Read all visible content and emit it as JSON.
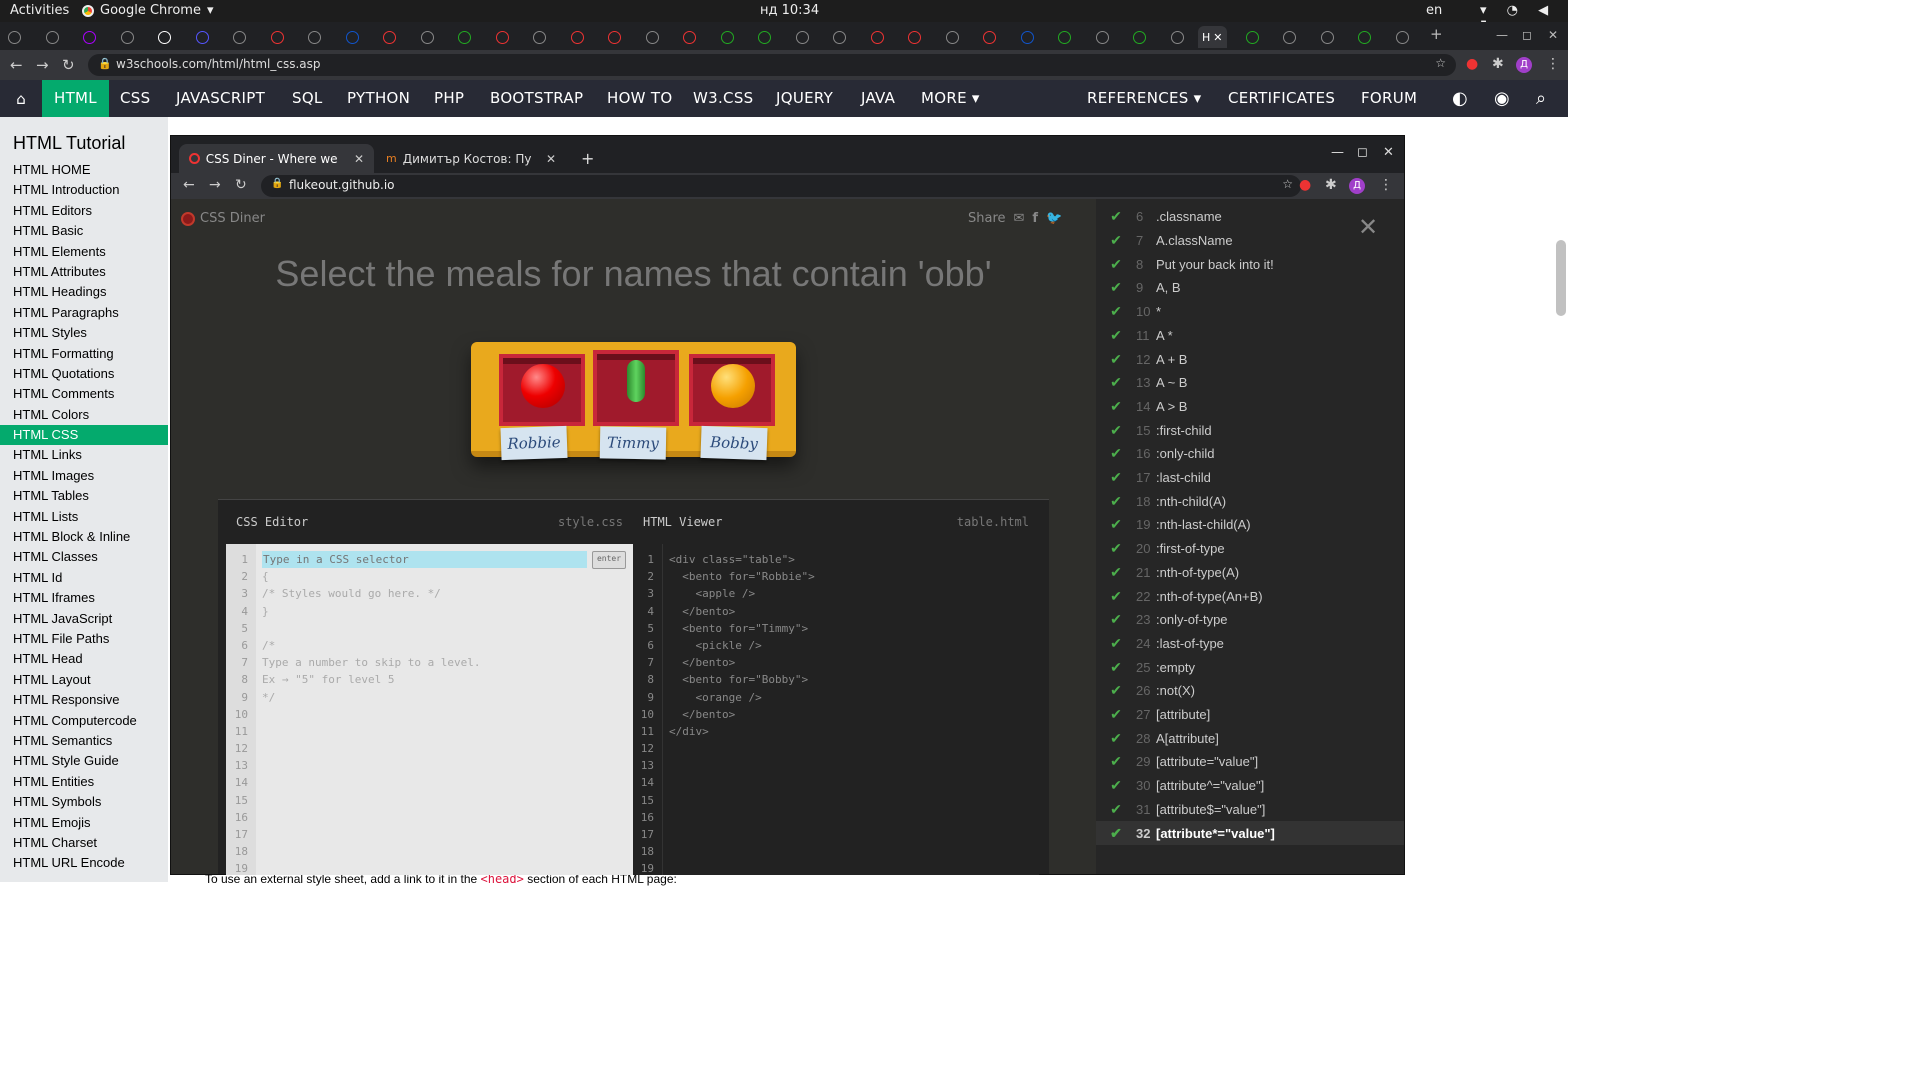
{
  "os": {
    "activities": "Activities",
    "app": "Google Chrome",
    "clock": "нд 10:34",
    "lang": "en"
  },
  "browser": {
    "url": "w3schools.com/html/html_css.asp",
    "active_tab": "H"
  },
  "w3nav": {
    "items": [
      "HTML",
      "CSS",
      "JAVASCRIPT",
      "SQL",
      "PYTHON",
      "PHP",
      "BOOTSTRAP",
      "HOW TO",
      "W3.CSS",
      "JQUERY",
      "JAVA",
      "MORE ▾"
    ],
    "right": [
      "REFERENCES ▾",
      "CERTIFICATES",
      "FORUM"
    ]
  },
  "sidebar": {
    "title": "HTML Tutorial",
    "items": [
      "HTML HOME",
      "HTML Introduction",
      "HTML Editors",
      "HTML Basic",
      "HTML Elements",
      "HTML Attributes",
      "HTML Headings",
      "HTML Paragraphs",
      "HTML Styles",
      "HTML Formatting",
      "HTML Quotations",
      "HTML Comments",
      "HTML Colors",
      "HTML CSS",
      "HTML Links",
      "HTML Images",
      "HTML Tables",
      "HTML Lists",
      "HTML Block & Inline",
      "HTML Classes",
      "HTML Id",
      "HTML Iframes",
      "HTML JavaScript",
      "HTML File Paths",
      "HTML Head",
      "HTML Layout",
      "HTML Responsive",
      "HTML Computercode",
      "HTML Semantics",
      "HTML Style Guide",
      "HTML Entities",
      "HTML Symbols",
      "HTML Emojis",
      "HTML Charset",
      "HTML URL Encode"
    ],
    "active": "HTML CSS"
  },
  "bottom_text": {
    "before": "To use an external style sheet, add a link to it in the ",
    "code": "<head>",
    "after": " section of each HTML page:"
  },
  "popup": {
    "tabs": [
      "CSS Diner - Where we feas",
      "Димитър Костов: Публи"
    ],
    "url": "flukeout.github.io",
    "brand": "CSS Diner",
    "share": "Share",
    "instruction": "Select the meals for names that contain 'obb'",
    "bentos": [
      {
        "name": "Robbie",
        "food": "apple"
      },
      {
        "name": "Timmy",
        "food": "pickle"
      },
      {
        "name": "Bobby",
        "food": "orange"
      }
    ],
    "css_editor": {
      "title": "CSS Editor",
      "file": "style.css",
      "placeholder": "Type in a CSS selector",
      "enter": "enter",
      "lines": [
        "{",
        "/* Styles would go here. */",
        "}",
        "",
        "/*",
        "Type a number to skip to a level.",
        "Ex → \"5\" for level 5",
        "*/"
      ]
    },
    "html_viewer": {
      "title": "HTML Viewer",
      "file": "table.html",
      "lines": [
        "<div class=\"table\">",
        "  <bento for=\"Robbie\">",
        "    <apple />",
        "  </bento>",
        "  <bento for=\"Timmy\">",
        "    <pickle />",
        "  </bento>",
        "  <bento for=\"Bobby\">",
        "    <orange />",
        "  </bento>",
        "</div>"
      ]
    },
    "levels": [
      {
        "n": "6",
        "t": ".classname"
      },
      {
        "n": "7",
        "t": "A.className"
      },
      {
        "n": "8",
        "t": "Put your back into it!"
      },
      {
        "n": "9",
        "t": "A, B"
      },
      {
        "n": "10",
        "t": "*"
      },
      {
        "n": "11",
        "t": "A *"
      },
      {
        "n": "12",
        "t": "A + B"
      },
      {
        "n": "13",
        "t": "A ~ B"
      },
      {
        "n": "14",
        "t": "A > B"
      },
      {
        "n": "15",
        "t": ":first-child"
      },
      {
        "n": "16",
        "t": ":only-child"
      },
      {
        "n": "17",
        "t": ":last-child"
      },
      {
        "n": "18",
        "t": ":nth-child(A)"
      },
      {
        "n": "19",
        "t": ":nth-last-child(A)"
      },
      {
        "n": "20",
        "t": ":first-of-type"
      },
      {
        "n": "21",
        "t": ":nth-of-type(A)"
      },
      {
        "n": "22",
        "t": ":nth-of-type(An+B)"
      },
      {
        "n": "23",
        "t": ":only-of-type"
      },
      {
        "n": "24",
        "t": ":last-of-type"
      },
      {
        "n": "25",
        "t": ":empty"
      },
      {
        "n": "26",
        "t": ":not(X)"
      },
      {
        "n": "27",
        "t": "[attribute]"
      },
      {
        "n": "28",
        "t": "A[attribute]"
      },
      {
        "n": "29",
        "t": "[attribute=\"value\"]"
      },
      {
        "n": "30",
        "t": "[attribute^=\"value\"]"
      },
      {
        "n": "31",
        "t": "[attribute$=\"value\"]"
      },
      {
        "n": "32",
        "t": "[attribute*=\"value\"]"
      }
    ],
    "current_level": "32"
  },
  "colors": {
    "w3_green": "#04AA6D",
    "w3_dark": "#282A35",
    "check": "#4cae4c"
  }
}
